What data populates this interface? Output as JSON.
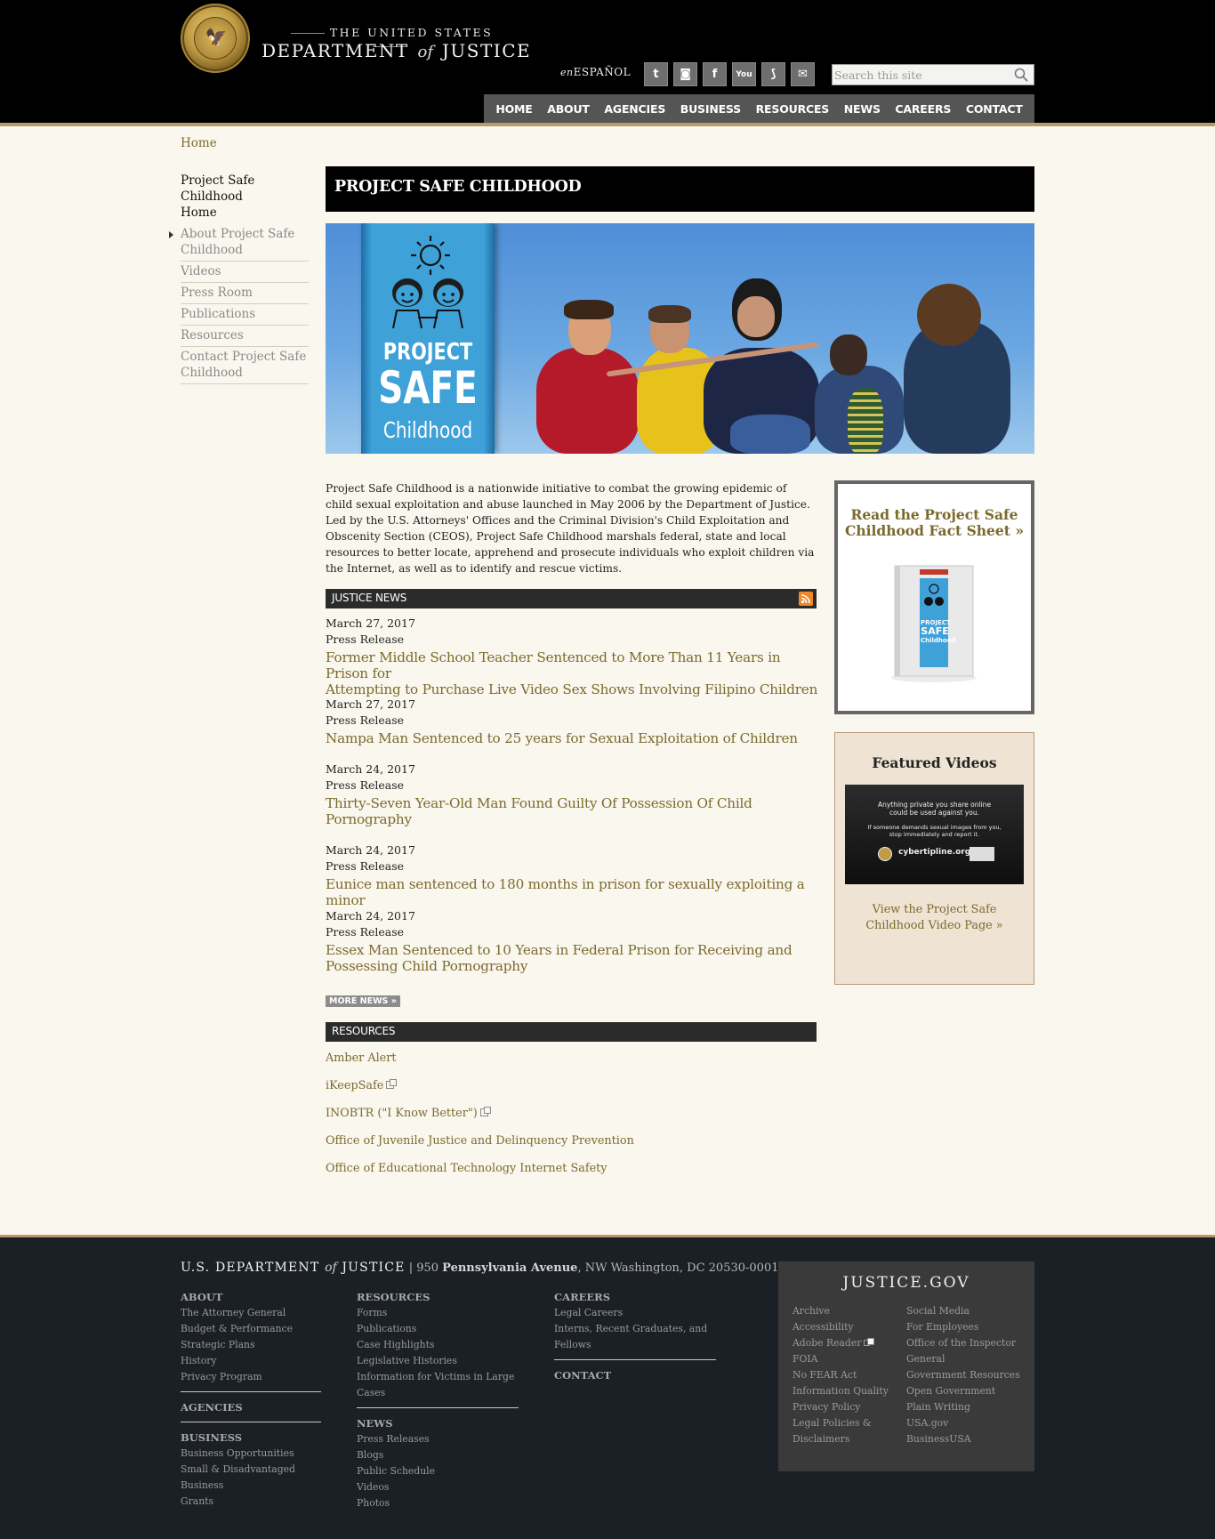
{
  "header": {
    "brand_top": "THE UNITED STATES",
    "brand_main_left": "DEPARTMENT",
    "brand_main_of": "of",
    "brand_main_right": "JUSTICE",
    "espanol_prefix": "en",
    "espanol_label": "ESPAÑOL",
    "social": [
      {
        "name": "twitter-icon",
        "glyph": "t"
      },
      {
        "name": "instagram-icon",
        "glyph": "◙"
      },
      {
        "name": "facebook-icon",
        "glyph": "f"
      },
      {
        "name": "youtube-icon",
        "glyph": "You"
      },
      {
        "name": "rss-icon",
        "glyph": "⟆"
      },
      {
        "name": "email-icon",
        "glyph": "✉"
      }
    ],
    "search_placeholder": "Search this site",
    "nav": [
      "HOME",
      "ABOUT",
      "AGENCIES",
      "BUSINESS",
      "RESOURCES",
      "NEWS",
      "CAREERS",
      "CONTACT"
    ]
  },
  "breadcrumb": "Home",
  "sidebar": {
    "current_line1": "Project Safe Childhood",
    "current_line2": "Home",
    "items": [
      {
        "line1": "About Project Safe",
        "line2": "Childhood"
      },
      {
        "line1": "Videos",
        "line2": ""
      },
      {
        "line1": "Press Room",
        "line2": ""
      },
      {
        "line1": "Publications",
        "line2": ""
      },
      {
        "line1": "Resources",
        "line2": ""
      },
      {
        "line1": "Contact Project Safe",
        "line2": "Childhood"
      }
    ]
  },
  "main": {
    "title": "PROJECT SAFE CHILDHOOD",
    "banner_logo": {
      "line1": "PROJECT",
      "line2": "SAFE",
      "line3": "Childhood"
    },
    "intro": "Project Safe Childhood is a nationwide initiative to combat the growing epidemic of child sexual exploitation and abuse launched in May 2006 by the Department of Justice.  Led by the U.S. Attorneys' Offices and the Criminal Division's Child Exploitation and Obscenity Section (CEOS), Project Safe Childhood marshals federal, state and local resources to better locate, apprehend and prosecute individuals who exploit children via the Internet, as well as to identify and rescue victims.",
    "news_header": "JUSTICE NEWS",
    "news": [
      {
        "date": "March 27, 2017",
        "type": "Press Release",
        "title_l1": "Former Middle School Teacher Sentenced to More Than 11 Years in Prison for",
        "title_l2": "Attempting to Purchase Live Video Sex Shows Involving Filipino Children"
      },
      {
        "date": "March 27, 2017",
        "type": "Press Release",
        "title_l1": "Nampa Man Sentenced to 25 years for Sexual Exploitation of Children",
        "title_l2": ""
      },
      {
        "date": "March 24, 2017",
        "type": "Press Release",
        "title_l1": "Thirty-Seven Year-Old Man Found Guilty Of Possession Of Child",
        "title_l2": "Pornography"
      },
      {
        "date": "March 24, 2017",
        "type": "Press Release",
        "title_l1": "Eunice man sentenced to 180 months in prison for sexually exploiting a minor",
        "title_l2": ""
      },
      {
        "date": "March 24, 2017",
        "type": "Press Release",
        "title_l1": "Essex Man Sentenced to 10 Years in Federal Prison for Receiving and",
        "title_l2": "Possessing Child Pornography"
      }
    ],
    "more_news": "MORE NEWS »",
    "resources_header": "RESOURCES",
    "resources": [
      "Amber Alert",
      "iKeepSafe",
      "INOBTR (\"I Know Better\")",
      "Office of Juvenile Justice and Delinquency Prevention",
      "Office of Educational Technology Internet Safety"
    ]
  },
  "factsheet": {
    "line1": "Read the Project Safe",
    "line2": "Childhood Fact Sheet »"
  },
  "featured_videos": {
    "title": "Featured Videos",
    "thumb_line1a": "Anything private you share online",
    "thumb_line1b": "could be used against you.",
    "thumb_line2a": "If someone demands sexual images from you,",
    "thumb_line2b": "stop immediately and report it.",
    "thumb_url": "cybertipline.org",
    "link_l1": "View the Project Safe",
    "link_l2": "Childhood Video Page »"
  },
  "footer": {
    "brand_left": "U.S. DEPARTMENT",
    "brand_of": "of",
    "brand_right": "JUSTICE",
    "address_pre": " | 950 ",
    "address_bold": "Pennsylvania Avenue",
    "address_post": ", NW Washington, DC 20530-0001",
    "col1": {
      "about": "ABOUT",
      "about_links": [
        "The Attorney General",
        "Budget & Performance",
        "Strategic Plans",
        "History",
        "Privacy Program"
      ],
      "agencies": "AGENCIES",
      "business": "BUSINESS",
      "business_links": [
        "Business Opportunities",
        "Small & Disadvantaged Business",
        "Grants"
      ]
    },
    "col2": {
      "resources": "RESOURCES",
      "resources_links": [
        "Forms",
        "Publications",
        "Case Highlights",
        "Legislative Histories",
        "Information for Victims in Large",
        "Cases"
      ],
      "news": "NEWS",
      "news_links": [
        "Press Releases",
        "Blogs",
        "Public Schedule",
        "Videos",
        "Photos"
      ]
    },
    "col3": {
      "careers": "CAREERS",
      "careers_links": [
        "Legal Careers",
        "Interns, Recent Graduates, and",
        "Fellows"
      ],
      "contact": "CONTACT"
    },
    "gov": {
      "title": "JUSTICE.GOV",
      "left": [
        "Archive",
        "Accessibility",
        "Adobe Reader",
        "FOIA",
        "No FEAR Act",
        "Information Quality",
        "Privacy Policy",
        "Legal Policies &",
        "Disclaimers"
      ],
      "right": [
        "Social Media",
        "For Employees",
        "Office of the Inspector",
        "General",
        "Government Resources",
        "Open Government",
        "Plain Writing",
        "USA.gov",
        "BusinessUSA"
      ]
    }
  }
}
